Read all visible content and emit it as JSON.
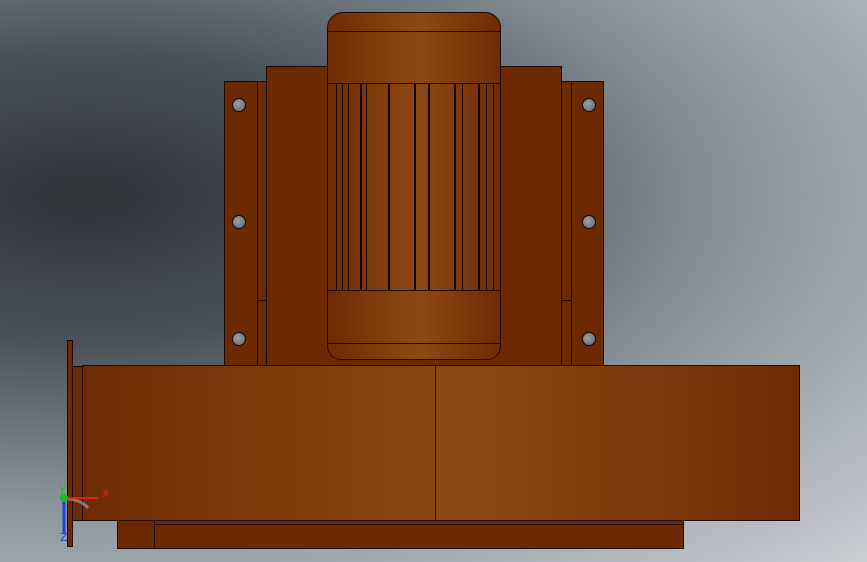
{
  "viewport": {
    "background": "#9aa1a8"
  },
  "model": {
    "material_color": "#7a3507",
    "edge_color": "#1e0a00",
    "hole_color": "#6f777e"
  },
  "triad": {
    "x_label": "X",
    "y_label": "Y",
    "z_label": "Z",
    "x_color": "#e02020",
    "y_color": "#10c020",
    "z_color": "#2040e0"
  }
}
